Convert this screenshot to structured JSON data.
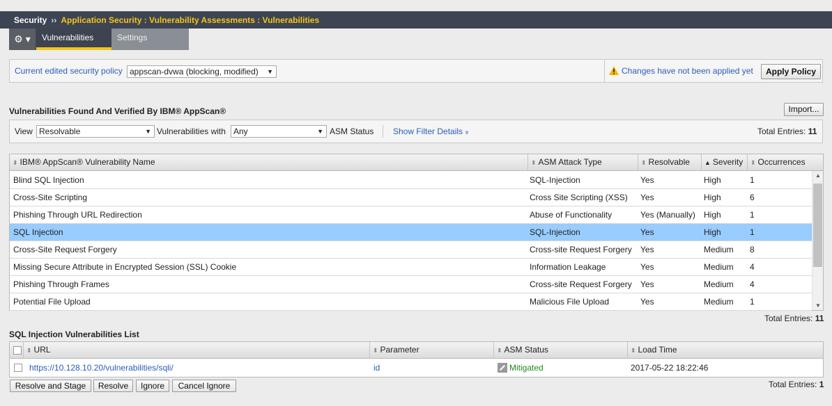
{
  "topbar": {
    "section": "Security",
    "separator": "››",
    "crumb": "Application Security : Vulnerability Assessments : Vulnerabilities"
  },
  "tabs": {
    "gear": "⚙ ▾",
    "active": "Vulnerabilities",
    "inactive": "Settings"
  },
  "policy": {
    "label": "Current edited security policy",
    "value": "appscan-dvwa (blocking, modified)",
    "warning": "Changes have not been applied yet",
    "apply_button": "Apply Policy"
  },
  "found": {
    "title": "Vulnerabilities Found And Verified By IBM® AppScan®",
    "import_button": "Import...",
    "filter": {
      "view_label": "View",
      "view_value": "Resolvable",
      "with_label": "Vulnerabilities with",
      "with_value": "Any",
      "asm_label": "ASM Status",
      "show_filter": "Show Filter Details",
      "show_filter_icon": "»",
      "total_label": "Total Entries:",
      "total_value": "11"
    },
    "columns": [
      "IBM® AppScan® Vulnerability Name",
      "ASM Attack Type",
      "Resolvable",
      "Severity",
      "Occurrences"
    ],
    "rows": [
      {
        "name": "Blind SQL Injection",
        "type": "SQL-Injection",
        "resolvable": "Yes",
        "severity": "High",
        "occ": "1"
      },
      {
        "name": "Cross-Site Scripting",
        "type": "Cross Site Scripting (XSS)",
        "resolvable": "Yes",
        "severity": "High",
        "occ": "6"
      },
      {
        "name": "Phishing Through URL Redirection",
        "type": "Abuse of Functionality",
        "resolvable": "Yes (Manually)",
        "severity": "High",
        "occ": "1"
      },
      {
        "name": "SQL Injection",
        "type": "SQL-Injection",
        "resolvable": "Yes",
        "severity": "High",
        "occ": "1"
      },
      {
        "name": "Cross-Site Request Forgery",
        "type": "Cross-site Request Forgery",
        "resolvable": "Yes",
        "severity": "Medium",
        "occ": "8"
      },
      {
        "name": "Missing Secure Attribute in Encrypted Session (SSL) Cookie",
        "type": "Information Leakage",
        "resolvable": "Yes",
        "severity": "Medium",
        "occ": "4"
      },
      {
        "name": "Phishing Through Frames",
        "type": "Cross-site Request Forgery",
        "resolvable": "Yes",
        "severity": "Medium",
        "occ": "4"
      },
      {
        "name": "Potential File Upload",
        "type": "Malicious File Upload",
        "resolvable": "Yes",
        "severity": "Medium",
        "occ": "1"
      }
    ],
    "bottom_total_label": "Total Entries:",
    "bottom_total_value": "11"
  },
  "sqli": {
    "title": "SQL Injection Vulnerabilities List",
    "columns": [
      "URL",
      "Parameter",
      "ASM Status",
      "Load Time"
    ],
    "rows": [
      {
        "url": "https://10.128.10.20/vulnerabilities/sqli/",
        "param": "id",
        "status": "Mitigated",
        "time": "2017-05-22 18:22:46"
      }
    ],
    "buttons": [
      "Resolve and Stage",
      "Resolve",
      "Ignore",
      "Cancel Ignore"
    ],
    "total_label": "Total Entries:",
    "total_value": "1"
  },
  "colors": {
    "crumb": "#f5c518",
    "selected_row": "#99ccff",
    "link": "#2b5db8",
    "mitigated": "#1b8a1b"
  }
}
